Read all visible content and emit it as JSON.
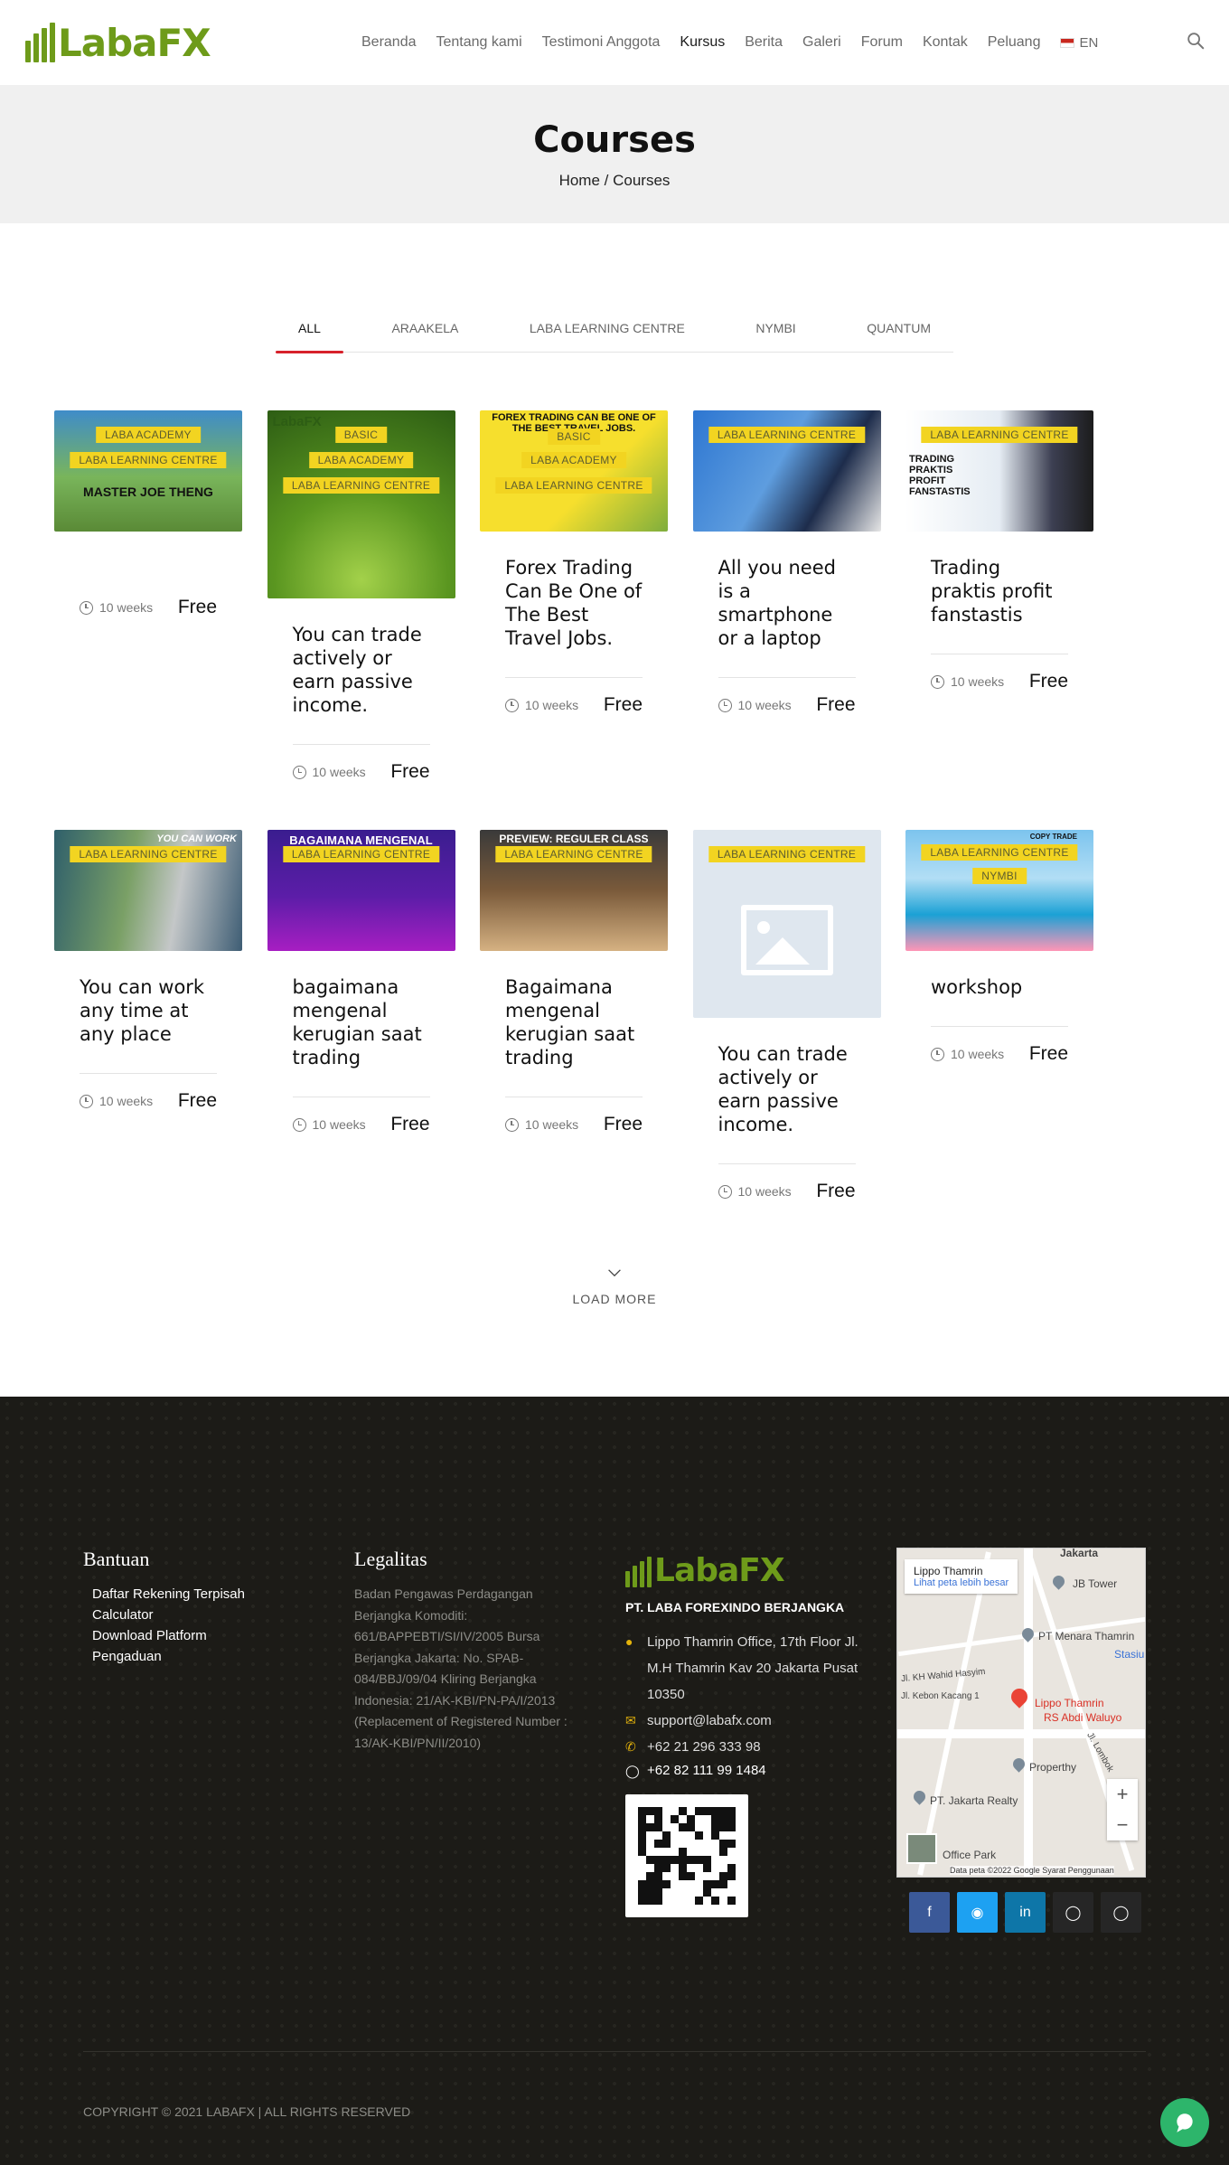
{
  "header": {
    "logo_text": "LabaFX",
    "nav": [
      "Beranda",
      "Tentang kami",
      "Testimoni Anggota",
      "Kursus",
      "Berita",
      "Galeri",
      "Forum",
      "Kontak",
      "Peluang"
    ],
    "active_nav": "Kursus",
    "language": "EN"
  },
  "page": {
    "title": "Courses",
    "breadcrumb": "Home / Courses"
  },
  "tabs": [
    "ALL",
    "ARAAKELA",
    "LABA LEARNING CENTRE",
    "NYMBI",
    "QUANTUM"
  ],
  "courses": [
    {
      "title": "",
      "duration": "10 weeks",
      "price": "Free",
      "tags": [
        "LABA ACADEMY",
        "LABA LEARNING CENTRE"
      ],
      "image_text": "MASTER JOE THENG"
    },
    {
      "title": "You can trade actively or earn passive income.",
      "duration": "10 weeks",
      "price": "Free",
      "tags": [
        "BASIC",
        "LABA ACADEMY",
        "LABA LEARNING CENTRE"
      ],
      "image_text": "LabaFX"
    },
    {
      "title": "Forex Trading Can Be One of The Best Travel Jobs.",
      "duration": "10 weeks",
      "price": "Free",
      "tags": [
        "BASIC",
        "LABA ACADEMY",
        "LABA LEARNING CENTRE"
      ],
      "image_text": "FOREX TRADING CAN BE ONE OF THE BEST TRAVEL JOBS."
    },
    {
      "title": "All you need is a smartphone or a laptop",
      "duration": "10 weeks",
      "price": "Free",
      "tags": [
        "LABA LEARNING CENTRE"
      ],
      "image_text": ""
    },
    {
      "title": "Trading praktis profit fanstastis",
      "duration": "10 weeks",
      "price": "Free",
      "tags": [
        "LABA LEARNING CENTRE"
      ],
      "image_text": "TRADING PRAKTIS PROFIT FANSTASTIS"
    },
    {
      "title": "You can work any time at any place",
      "duration": "10 weeks",
      "price": "Free",
      "tags": [
        "LABA LEARNING CENTRE"
      ],
      "image_text": "YOU CAN WORK"
    },
    {
      "title": "bagaimana mengenal kerugian saat trading",
      "duration": "10 weeks",
      "price": "Free",
      "tags": [
        "LABA LEARNING CENTRE"
      ],
      "image_text": "BAGAIMANA MENGENAL"
    },
    {
      "title": "Bagaimana mengenal kerugian saat trading",
      "duration": "10 weeks",
      "price": "Free",
      "tags": [
        "LABA LEARNING CENTRE"
      ],
      "image_text": "PREVIEW: REGULER CLASS"
    },
    {
      "title": "You can trade actively or earn passive income.",
      "duration": "10 weeks",
      "price": "Free",
      "tags": [
        "LABA LEARNING CENTRE"
      ],
      "image_text": ""
    },
    {
      "title": "workshop",
      "duration": "10 weeks",
      "price": "Free",
      "tags": [
        "LABA LEARNING CENTRE",
        "NYMBI"
      ],
      "image_text": "COPY TRADE"
    }
  ],
  "load_more": "LOAD MORE",
  "footer": {
    "bantuan": {
      "heading": "Bantuan",
      "links": [
        "Daftar Rekening Terpisah",
        "Calculator",
        "Download Platform",
        "Pengaduan"
      ]
    },
    "legalitas": {
      "heading": "Legalitas",
      "text": "Badan Pengawas Perdagangan Berjangka Komoditi: 661/BAPPEBTI/SI/IV/2005 Bursa Berjangka Jakarta: No. SPAB-084/BBJ/09/04 Kliring Berjangka Indonesia: 21/AK-KBI/PN-PA/I/2013 (Replacement of Registered Number : 13/AK-KBI/PN/II/2010)"
    },
    "company": {
      "logo_text": "LabaFX",
      "name": "PT. LABA FOREXINDO BERJANGKA",
      "address": "Lippo Thamrin Office, 17th Floor Jl. M.H Thamrin Kav 20 Jakarta Pusat 10350",
      "email": "support@labafx.com",
      "phone": "+62 21 296 333 98",
      "whatsapp": "+62 82 111 99 1484"
    },
    "map": {
      "place": "Lippo Thamrin",
      "link": "Lihat peta lebih besar",
      "labels": [
        "JB Tower",
        "PT Menara Thamrin",
        "Lippo Thamrin",
        "RS Abdi Waluyo",
        "Properthy",
        "PT. Jakarta Realty",
        "Jakarta",
        "Stasiu",
        "Jl. KH Wahid Hasyim",
        "Jl. Kebon Kacang 1",
        "Jl. Lombok",
        "Office Park"
      ],
      "attribution": "Data peta ©2022 Google   Syarat Penggunaan"
    },
    "socials": [
      {
        "icon": "facebook-icon",
        "color": "#3b5998"
      },
      {
        "icon": "twitter-icon",
        "color": "#1da1f2"
      },
      {
        "icon": "linkedin-icon",
        "color": "#0e76a8"
      },
      {
        "icon": "instagram-icon",
        "color": "#262626"
      },
      {
        "icon": "instagram-icon",
        "color": "#262626"
      }
    ],
    "copyright": "COPYRIGHT © 2021 LABAFX | ALL RIGHTS RESERVED"
  },
  "colors": {
    "brand_green": "#6e9b1a",
    "tab_underline": "#d7212b",
    "tag_yellow": "#f2d421",
    "footer_bg": "#1c1b17",
    "chat_green": "#2db56b"
  }
}
